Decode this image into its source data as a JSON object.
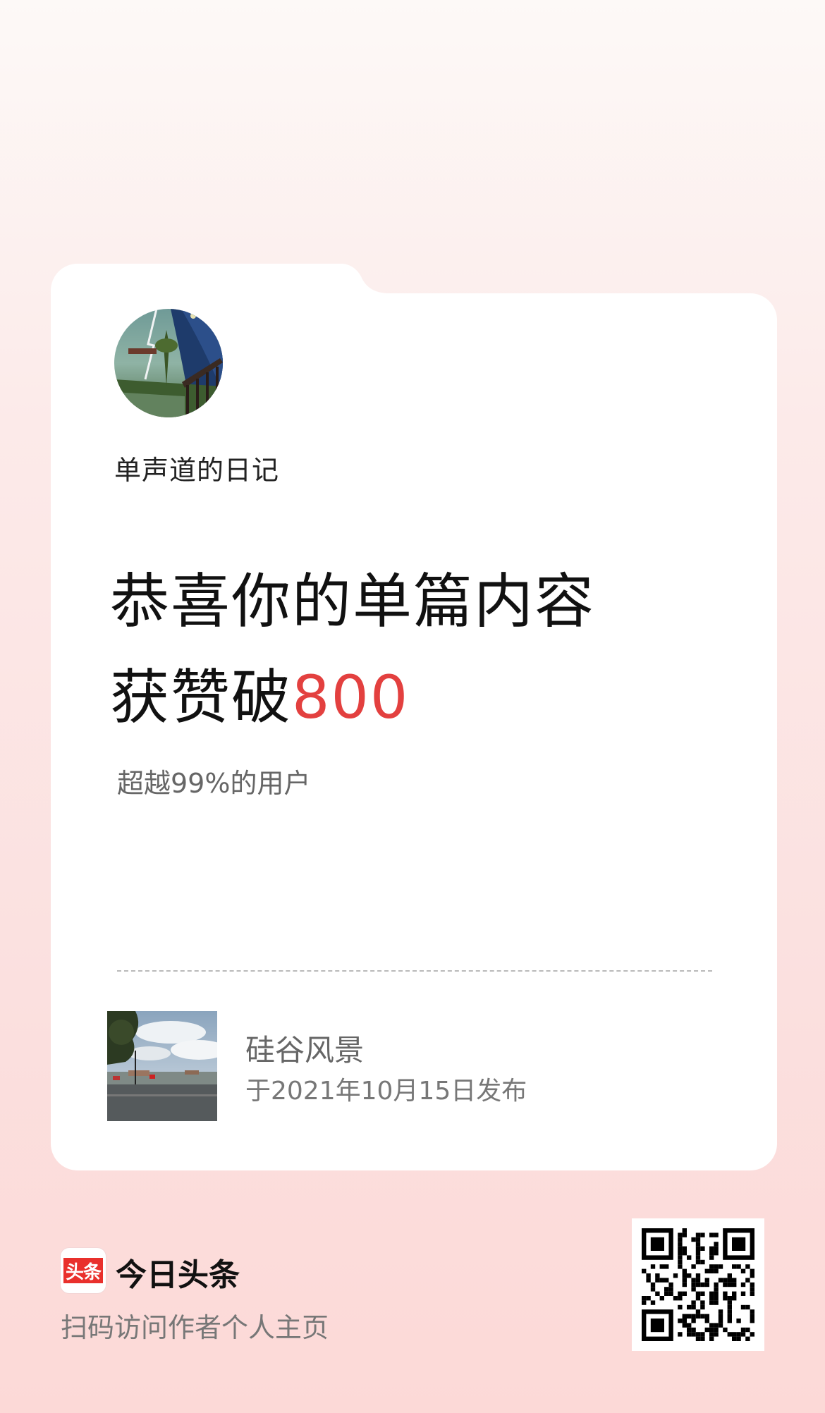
{
  "author": {
    "name": "单声道的日记"
  },
  "headline": {
    "line1": "恭喜你的单篇内容",
    "line2_prefix": "获赞破",
    "line2_number": "800"
  },
  "subtext": "超越99%的用户",
  "article": {
    "title": "硅谷风景",
    "published": "于2021年10月15日发布"
  },
  "footer": {
    "logo_text": "头条",
    "brand": "今日头条",
    "scan_hint": "扫码访问作者个人主页"
  },
  "colors": {
    "accent": "#e3403f",
    "logo_red": "#e9302c"
  }
}
